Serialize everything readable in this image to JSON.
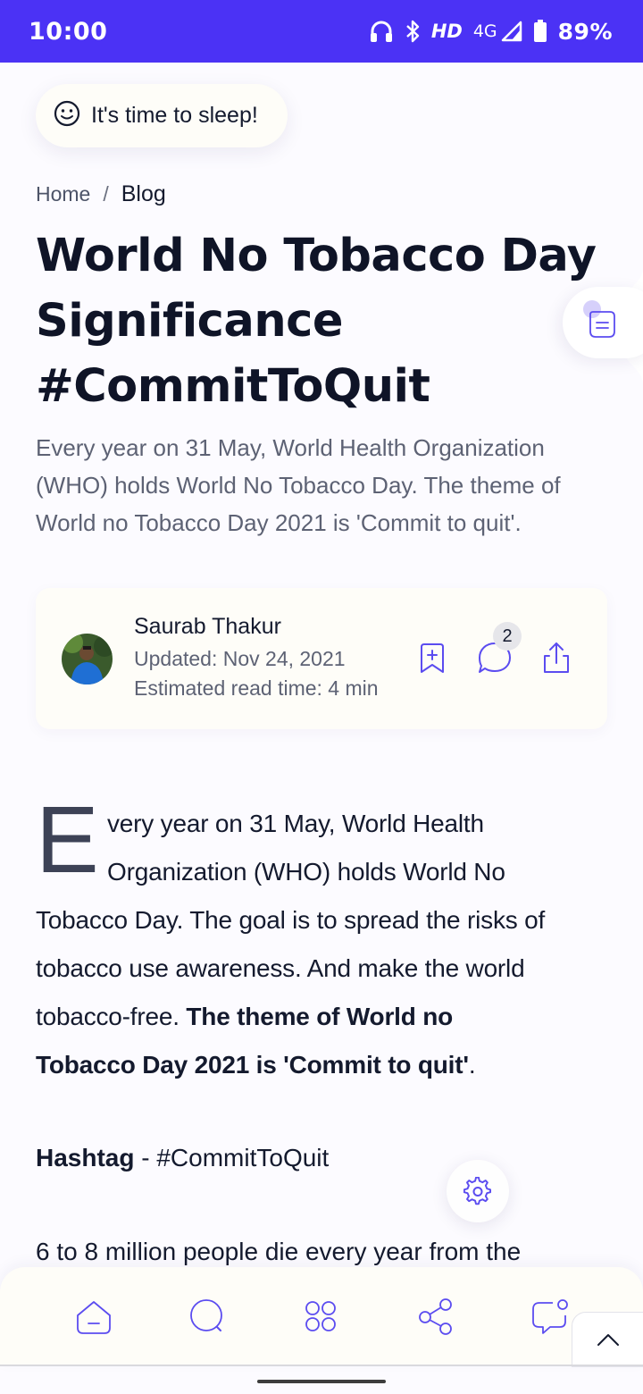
{
  "status_bar": {
    "time": "10:00",
    "hd_label": "HD",
    "network_label": "4G",
    "battery_percent": "89%",
    "icons": [
      "headphones-icon",
      "bluetooth-icon",
      "signal-icon",
      "battery-icon"
    ]
  },
  "greeting": {
    "text": "It's time to sleep!",
    "icon": "smiley-icon"
  },
  "breadcrumb": {
    "home": "Home",
    "separator": "/",
    "current": "Blog"
  },
  "article": {
    "title_lines": [
      "World No Tobacco Day",
      "Significance",
      "#CommitToQuit"
    ],
    "summary": "Every year on 31 May, World Health Organization (WHO) holds World No Tobacco Day. The theme of World no Tobacco Day 2021 is 'Commit to quit'.",
    "drop_cap": "E",
    "body_lines": [
      "very year on 31 May, World Health",
      "Organization (WHO) holds World No",
      "Tobacco Day. The goal is to spread the risks of",
      "tobacco use awareness. And make the world",
      "tobacco-free. "
    ],
    "body_bold_1": "The theme of  World no",
    "body_bold_2": "Tobacco Day 2021 is 'Commit to quit'",
    "body_end": ".",
    "hashtag_label": "Hashtag",
    "hashtag_value": " - #CommitToQuit",
    "stat_line": "6 to 8 million people die every year from the"
  },
  "author": {
    "name": "Saurab Thakur",
    "updated": "Updated: Nov 24, 2021",
    "read_time": "Estimated read time: 4 min",
    "comment_count": "2"
  },
  "bottom_nav": {
    "items": [
      "home-icon",
      "search-icon",
      "apps-icon",
      "share-network-icon",
      "chat-icon"
    ]
  },
  "colors": {
    "status_bar": "#4b32f5",
    "accent": "#5b4cf0",
    "text": "#141a2e",
    "muted": "#5d6274"
  }
}
